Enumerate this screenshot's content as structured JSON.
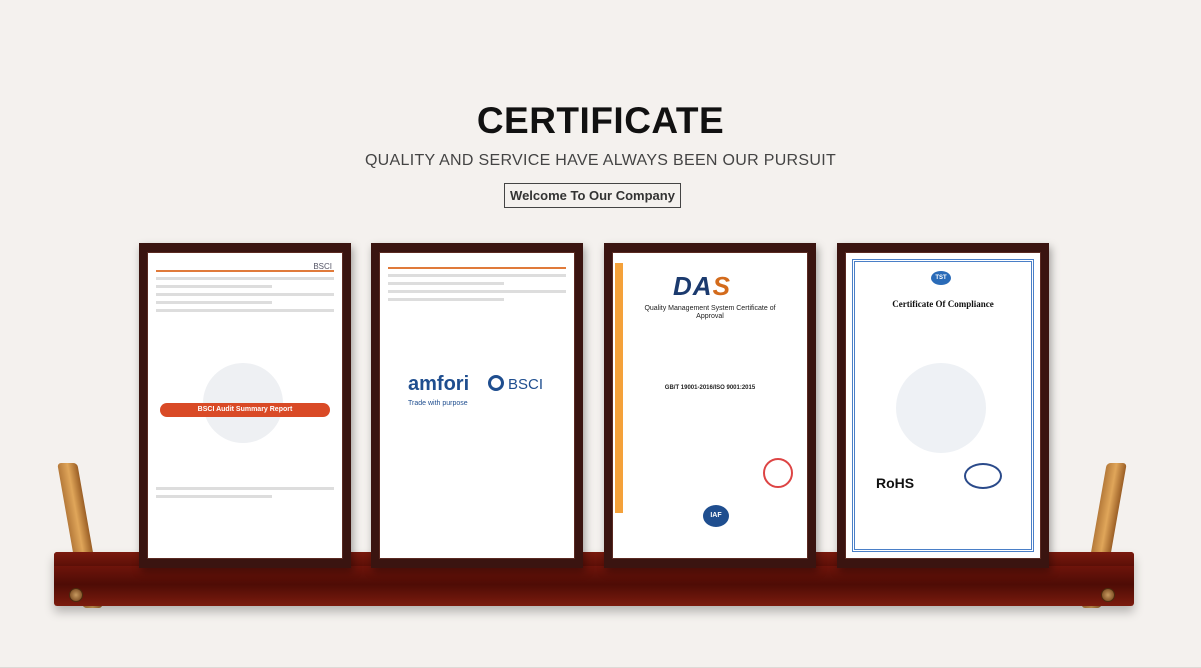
{
  "header": {
    "title": "CERTIFICATE",
    "subtitle": "QUALITY AND SERVICE HAVE ALWAYS BEEN OUR PURSUIT",
    "button_label": "Welcome To Our Company"
  },
  "certificates": [
    {
      "bsci_logo": "BSCI",
      "banner": "BSCI Audit Summary Report"
    },
    {
      "brand": "amfori",
      "brand_suffix": "BSCI",
      "tagline": "Trade with purpose"
    },
    {
      "logo_left": "DA",
      "logo_right": "S",
      "title": "Quality Management System Certificate of Approval",
      "standard": "GB/T 19001-2016/ISO 9001:2015",
      "badge": "IAF"
    },
    {
      "logo": "TST",
      "title": "Certificate Of Compliance",
      "mark": "RoHS"
    }
  ],
  "colors": {
    "background": "#f4f1ee",
    "frame": "#3a1410",
    "shelf": "#6a130a",
    "accent_orange": "#d94a26",
    "amfori_blue": "#1f4e8f"
  }
}
